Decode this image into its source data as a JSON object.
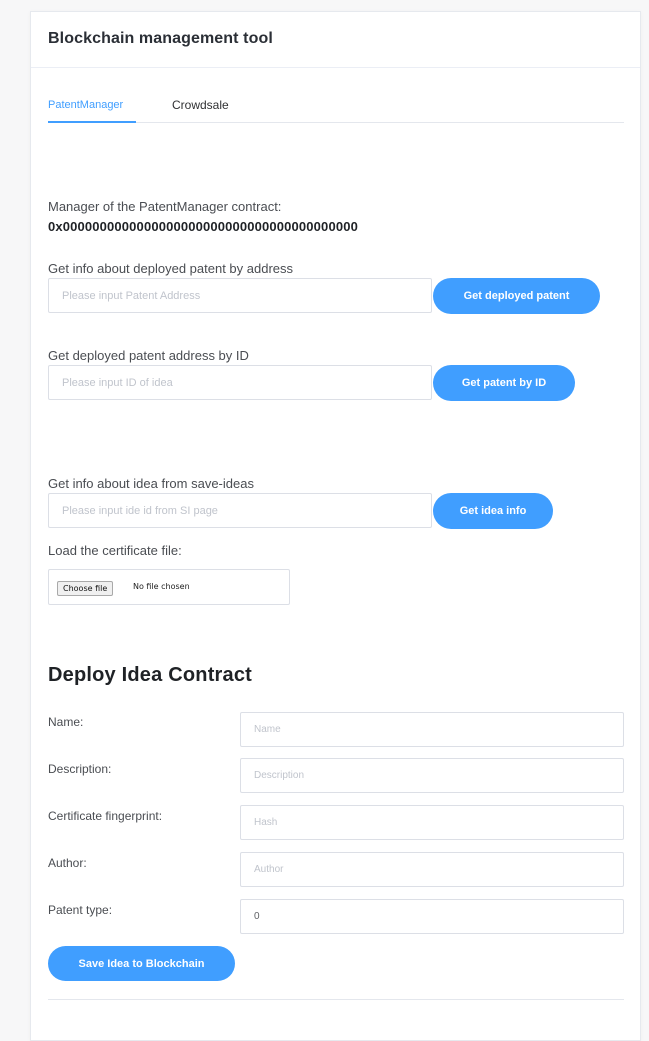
{
  "card": {
    "title": "Blockchain management tool"
  },
  "tabs": [
    {
      "label": "PatentManager",
      "active": true
    },
    {
      "label": "Crowdsale",
      "active": false
    }
  ],
  "manager": {
    "label": "Manager of the PatentManager contract:",
    "address": "0x0000000000000000000000000000000000000000"
  },
  "deployed_patent": {
    "label": "Get info about deployed patent by address",
    "placeholder": "Please input Patent Address",
    "value": "",
    "button": "Get deployed patent"
  },
  "patent_by_id": {
    "label": "Get deployed patent address by ID",
    "placeholder": "Please input ID of idea",
    "value": "",
    "button": "Get patent by ID"
  },
  "idea_info": {
    "label": "Get info about idea from save-ideas",
    "placeholder": "Please input ide id from SI page",
    "value": "",
    "button": "Get idea info"
  },
  "certificate": {
    "label": "Load the certificate file:",
    "choose_button": "Choose file",
    "status": "No file chosen"
  },
  "deploy": {
    "title": "Deploy Idea Contract",
    "fields": [
      {
        "label": "Name:",
        "placeholder": "Name",
        "value": ""
      },
      {
        "label": "Description:",
        "placeholder": "Description",
        "value": ""
      },
      {
        "label": "Certificate fingerprint:",
        "placeholder": "Hash",
        "value": ""
      },
      {
        "label": "Author:",
        "placeholder": "Author",
        "value": ""
      },
      {
        "label": "Patent type:",
        "placeholder": "",
        "value": "0"
      }
    ],
    "save_button": "Save Idea to Blockchain"
  },
  "colors": {
    "accent": "#409eff",
    "border": "#dcdfe6",
    "placeholder": "#c0c4cc"
  }
}
